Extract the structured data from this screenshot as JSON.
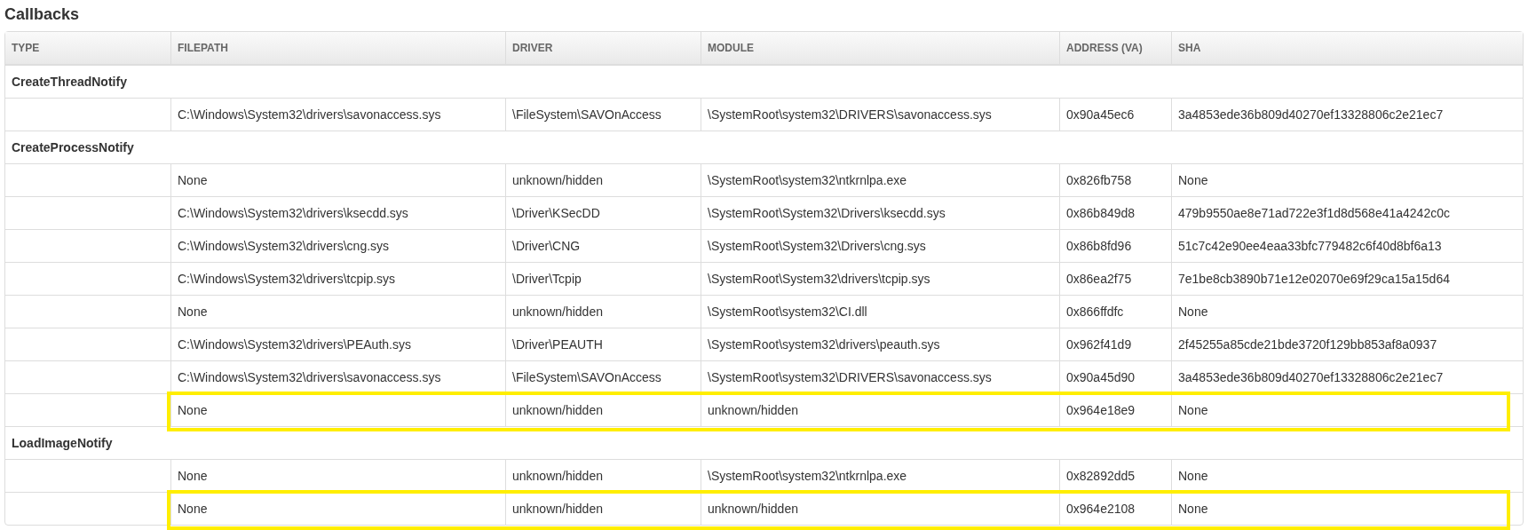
{
  "title": "Callbacks",
  "table": {
    "columns": [
      "TYPE",
      "FILEPATH",
      "DRIVER",
      "MODULE",
      "ADDRESS (VA)",
      "SHA"
    ],
    "groups": [
      {
        "type": "CreateThreadNotify",
        "rows": [
          {
            "filepath": "C:\\Windows\\System32\\drivers\\savonaccess.sys",
            "driver": "\\FileSystem\\SAVOnAccess",
            "module": "\\SystemRoot\\system32\\DRIVERS\\savonaccess.sys",
            "address": "0x90a45ec6",
            "sha": "3a4853ede36b809d40270ef13328806c2e21ec7",
            "highlighted": false
          }
        ]
      },
      {
        "type": "CreateProcessNotify",
        "rows": [
          {
            "filepath": "None",
            "driver": "unknown/hidden",
            "module": "\\SystemRoot\\system32\\ntkrnlpa.exe",
            "address": "0x826fb758",
            "sha": "None",
            "highlighted": false
          },
          {
            "filepath": "C:\\Windows\\System32\\drivers\\ksecdd.sys",
            "driver": "\\Driver\\KSecDD",
            "module": "\\SystemRoot\\System32\\Drivers\\ksecdd.sys",
            "address": "0x86b849d8",
            "sha": "479b9550ae8e71ad722e3f1d8d568e41a4242c0c",
            "highlighted": false
          },
          {
            "filepath": "C:\\Windows\\System32\\drivers\\cng.sys",
            "driver": "\\Driver\\CNG",
            "module": "\\SystemRoot\\System32\\Drivers\\cng.sys",
            "address": "0x86b8fd96",
            "sha": "51c7c42e90ee4eaa33bfc779482c6f40d8bf6a13",
            "highlighted": false
          },
          {
            "filepath": "C:\\Windows\\System32\\drivers\\tcpip.sys",
            "driver": "\\Driver\\Tcpip",
            "module": "\\SystemRoot\\System32\\drivers\\tcpip.sys",
            "address": "0x86ea2f75",
            "sha": "7e1be8cb3890b71e12e02070e69f29ca15a15d64",
            "highlighted": false
          },
          {
            "filepath": "None",
            "driver": "unknown/hidden",
            "module": "\\SystemRoot\\system32\\CI.dll",
            "address": "0x866ffdfc",
            "sha": "None",
            "highlighted": false
          },
          {
            "filepath": "C:\\Windows\\System32\\drivers\\PEAuth.sys",
            "driver": "\\Driver\\PEAUTH",
            "module": "\\SystemRoot\\system32\\drivers\\peauth.sys",
            "address": "0x962f41d9",
            "sha": "2f45255a85cde21bde3720f129bb853af8a0937",
            "highlighted": false
          },
          {
            "filepath": "C:\\Windows\\System32\\drivers\\savonaccess.sys",
            "driver": "\\FileSystem\\SAVOnAccess",
            "module": "\\SystemRoot\\system32\\DRIVERS\\savonaccess.sys",
            "address": "0x90a45d90",
            "sha": "3a4853ede36b809d40270ef13328806c2e21ec7",
            "highlighted": false
          },
          {
            "filepath": "None",
            "driver": "unknown/hidden",
            "module": "unknown/hidden",
            "address": "0x964e18e9",
            "sha": "None",
            "highlighted": true
          }
        ]
      },
      {
        "type": "LoadImageNotify",
        "rows": [
          {
            "filepath": "None",
            "driver": "unknown/hidden",
            "module": "\\SystemRoot\\system32\\ntkrnlpa.exe",
            "address": "0x82892dd5",
            "sha": "None",
            "highlighted": false
          },
          {
            "filepath": "None",
            "driver": "unknown/hidden",
            "module": "unknown/hidden",
            "address": "0x964e2108",
            "sha": "None",
            "highlighted": true
          }
        ]
      }
    ]
  }
}
